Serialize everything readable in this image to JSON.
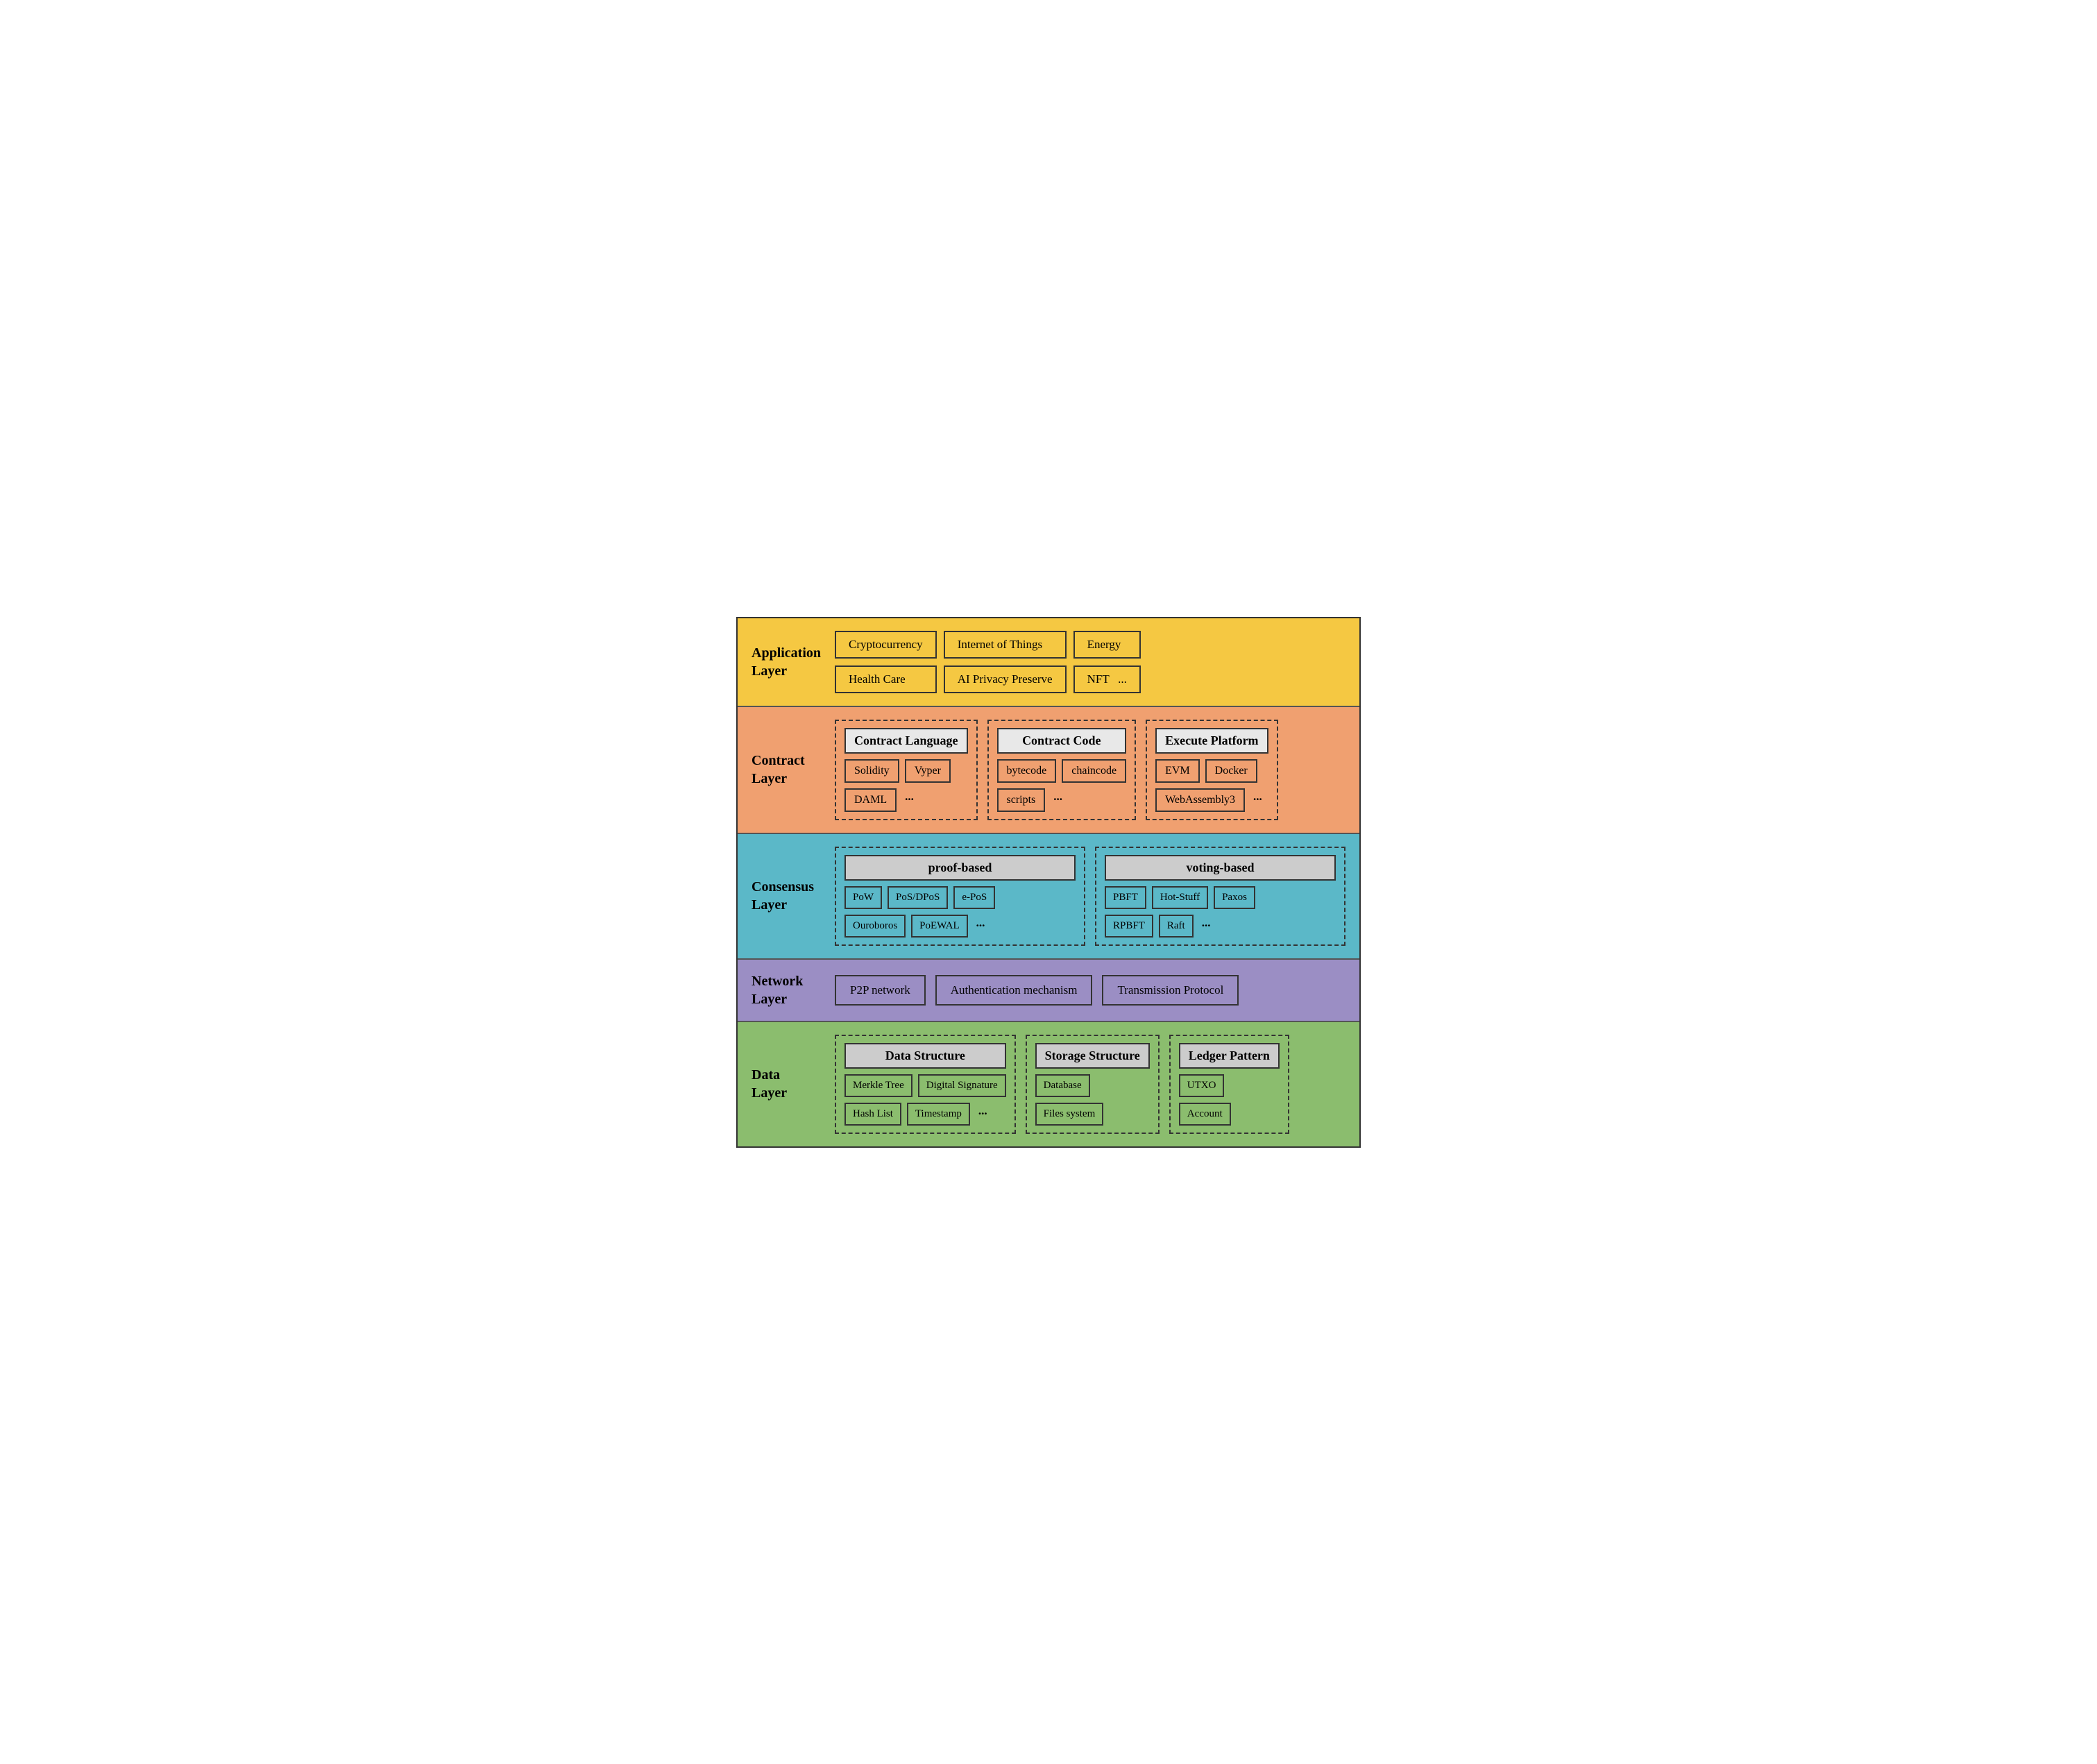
{
  "layers": {
    "application": {
      "label": "Application\nLayer",
      "background": "#F5C842",
      "items": [
        [
          "Cryptocurrency",
          "Internet of Things",
          "Energy"
        ],
        [
          "Health Care",
          "AI Privacy Preserve",
          "NFT   ..."
        ]
      ]
    },
    "contract": {
      "label": "Contract\nLayer",
      "background": "#F0A070",
      "groups": [
        {
          "title": "Contract Language",
          "items_row1": [
            "Solidity",
            "Vyper"
          ],
          "items_row2": [
            "DAML",
            "..."
          ]
        },
        {
          "title": "Contract Code",
          "items_row1": [
            "bytecode",
            "chaincode"
          ],
          "items_row2": [
            "scripts",
            "..."
          ]
        },
        {
          "title": "Execute Platform",
          "items_row1": [
            "EVM",
            "Docker"
          ],
          "items_row2": [
            "WebAssembly3",
            "..."
          ]
        }
      ]
    },
    "consensus": {
      "label": "Consensus\nLayer",
      "background": "#5BB8C8",
      "groups": [
        {
          "title": "proof-based",
          "items_row1": [
            "PoW",
            "PoS/DPoS",
            "e-PoS"
          ],
          "items_row2": [
            "Ouroboros",
            "PoEWAL",
            "..."
          ]
        },
        {
          "title": "voting-based",
          "items_row1": [
            "PBFT",
            "Hot-Stuff",
            "Paxos"
          ],
          "items_row2": [
            "RPBFT",
            "Raft",
            "..."
          ]
        }
      ]
    },
    "network": {
      "label": "Network\nLayer",
      "background": "#9B8EC4",
      "items": [
        "P2P network",
        "Authentication mechanism",
        "Transmission Protocol"
      ]
    },
    "data": {
      "label": "Data\nLayer",
      "background": "#8BBD6E",
      "groups": [
        {
          "title": "Data Structure",
          "items_row1": [
            "Merkle Tree",
            "Digital Signature"
          ],
          "items_row2": [
            "Hash List",
            "Timestamp",
            "..."
          ]
        },
        {
          "title": "Storage Structure",
          "items_row1": [
            "Database"
          ],
          "items_row2": [
            "Files system"
          ]
        },
        {
          "title": "Ledger Pattern",
          "items_row1": [
            "UTXO"
          ],
          "items_row2": [
            "Account"
          ]
        }
      ]
    }
  }
}
